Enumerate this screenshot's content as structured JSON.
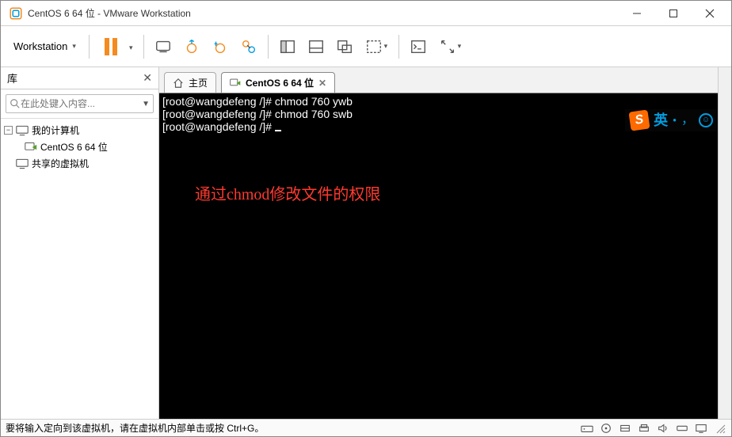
{
  "titlebar": {
    "title": "CentOS 6 64 位 - VMware Workstation"
  },
  "menu": {
    "workstation": "Workstation"
  },
  "sidebar": {
    "header": "库",
    "searchPlaceholder": "在此处键入内容...",
    "myComputer": "我的计算机",
    "centos": "CentOS 6 64 位",
    "sharedVMs": "共享的虚拟机"
  },
  "tabs": {
    "home": "主页",
    "centos": "CentOS 6 64 位"
  },
  "terminal": {
    "line1": "[root@wangdefeng /]# chmod 760 ywb",
    "line2": "[root@wangdefeng /]# chmod 760 swb",
    "line3": "[root@wangdefeng /]# "
  },
  "annotation": "通过chmod修改文件的权限",
  "ime": {
    "lang": "英"
  },
  "status": {
    "hint": "要将输入定向到该虚拟机，请在虚拟机内部单击或按 Ctrl+G。"
  },
  "colors": {
    "pauseOrange": "#f58b1f",
    "cyan": "#009de0",
    "red": "#ff3a2f"
  }
}
